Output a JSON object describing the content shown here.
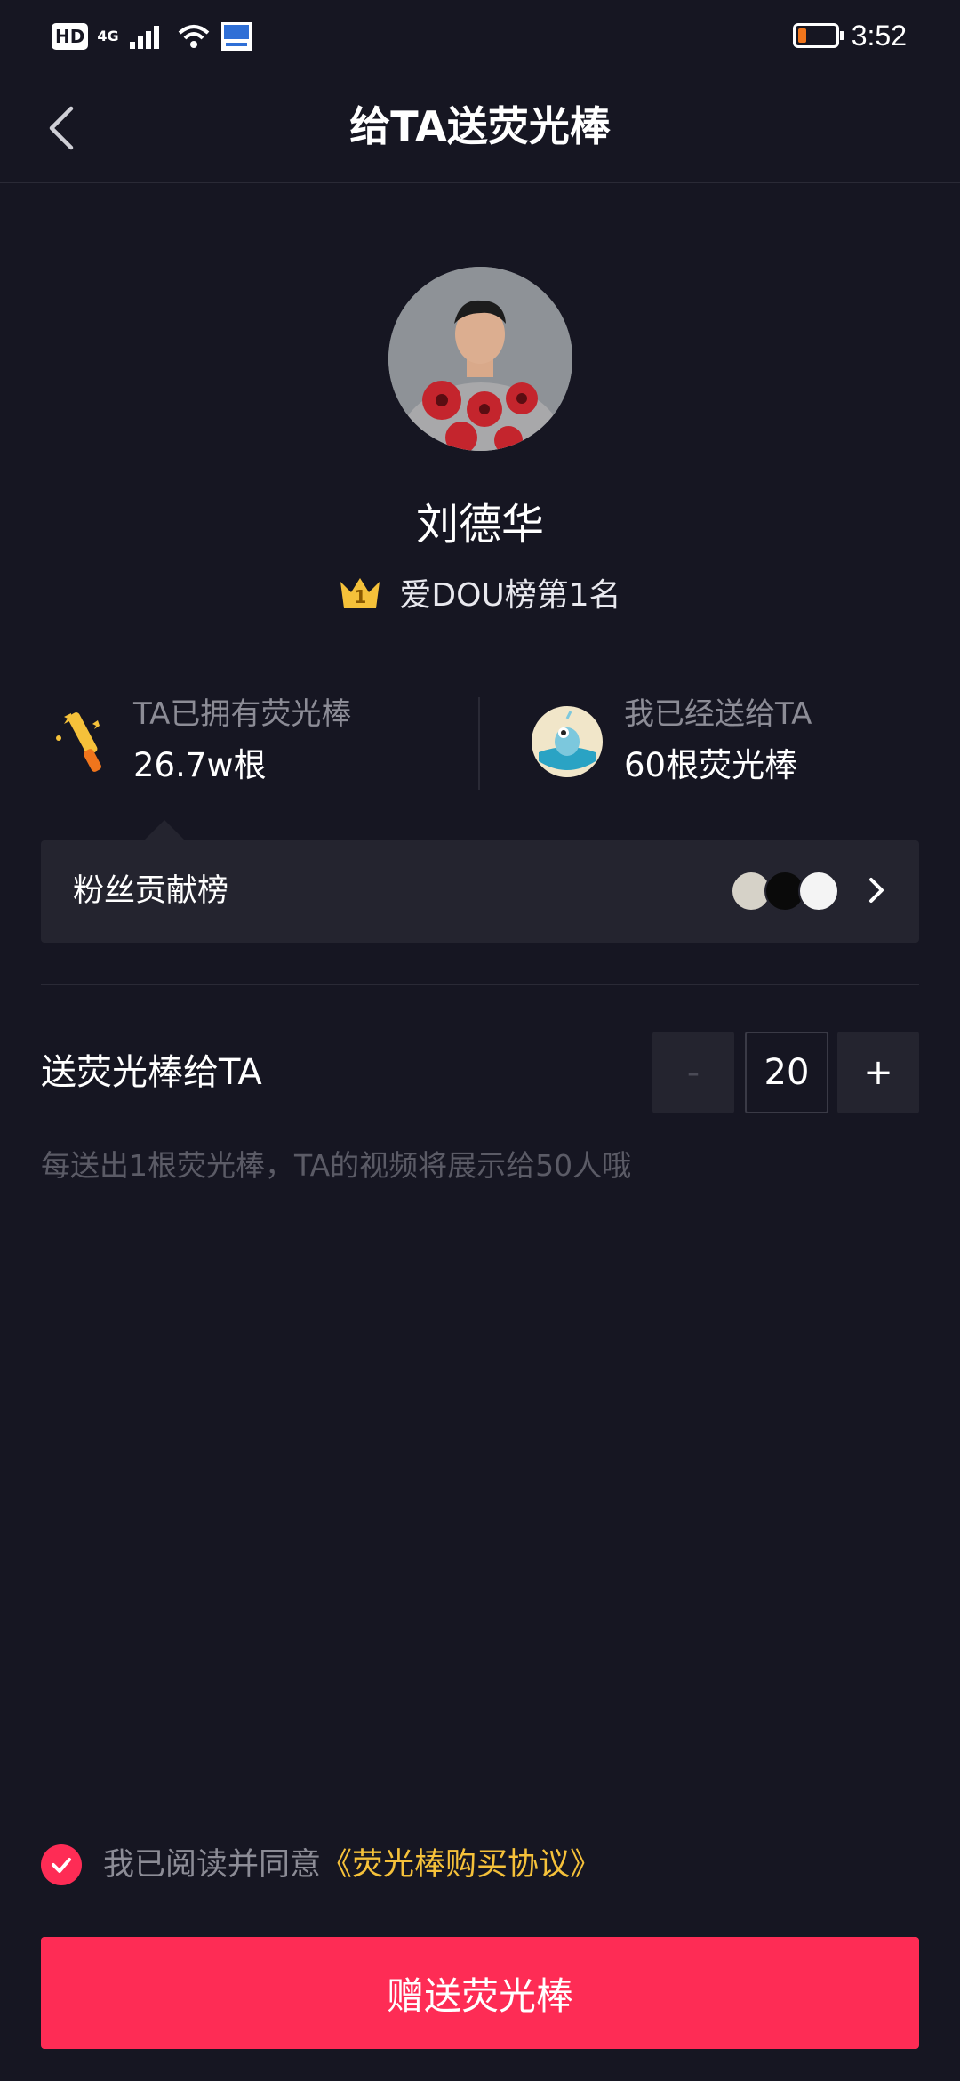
{
  "status_bar": {
    "hd": "HD",
    "network": "4G",
    "time": "3:52"
  },
  "nav": {
    "title": "给TA送荧光棒"
  },
  "profile": {
    "name": "刘德华",
    "rank_badge": "1",
    "rank_text": "爱DOU榜第1名"
  },
  "stats": {
    "owned_label": "TA已拥有荧光棒",
    "owned_value": "26.7w根",
    "sent_label": "我已经送给TA",
    "sent_value": "60根荧光棒"
  },
  "fans_board": {
    "label": "粉丝贡献榜"
  },
  "send": {
    "label": "送荧光棒给TA",
    "minus": "-",
    "quantity": "20",
    "plus": "+",
    "hint": "每送出1根荧光棒，TA的视频将展示给50人哦"
  },
  "agreement": {
    "prefix": "我已阅读并同意",
    "link": "《荧光棒购买协议》"
  },
  "submit": {
    "label": "赠送荧光棒"
  },
  "colors": {
    "background": "#161622",
    "accent": "#fe2c55",
    "link": "#f5c13a",
    "panel": "#24242f"
  }
}
